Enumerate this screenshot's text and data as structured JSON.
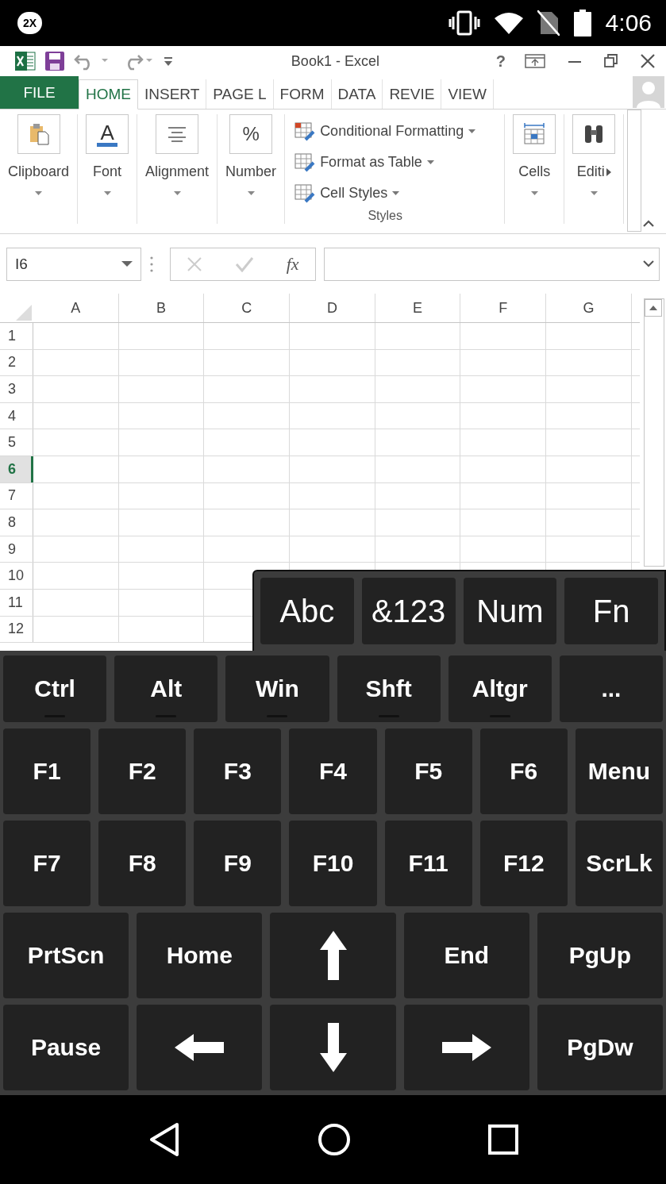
{
  "status_bar": {
    "app_badge": "2X",
    "time": "4:06"
  },
  "window": {
    "title": "Book1 - Excel",
    "help": "?"
  },
  "tabs": [
    {
      "label": "FILE",
      "kind": "file",
      "selected": false
    },
    {
      "label": "HOME",
      "kind": "tab",
      "selected": true
    },
    {
      "label": "INSERT",
      "kind": "tab",
      "selected": false
    },
    {
      "label": "PAGE L",
      "kind": "tab",
      "selected": false
    },
    {
      "label": "FORM",
      "kind": "tab",
      "selected": false
    },
    {
      "label": "DATA",
      "kind": "tab",
      "selected": false
    },
    {
      "label": "REVIE",
      "kind": "tab",
      "selected": false
    },
    {
      "label": "VIEW",
      "kind": "tab",
      "selected": false
    }
  ],
  "ribbon": {
    "groups": [
      {
        "kind": "clipboard",
        "label": "Clipboard"
      },
      {
        "kind": "font",
        "label": "Font",
        "glyph": "A"
      },
      {
        "kind": "alignment",
        "label": "Alignment"
      },
      {
        "kind": "number",
        "label": "Number",
        "glyph": "%"
      },
      {
        "kind": "styles",
        "label": "Styles",
        "items": [
          "Conditional Formatting",
          "Format as Table",
          "Cell Styles"
        ]
      },
      {
        "kind": "cells",
        "label": "Cells"
      },
      {
        "kind": "editing",
        "label": "Editi"
      }
    ]
  },
  "formula_bar": {
    "name_box": "I6",
    "function_button": "fx"
  },
  "sheet": {
    "columns": [
      "A",
      "B",
      "C",
      "D",
      "E",
      "F",
      "G"
    ],
    "rows": [
      {
        "label": "1",
        "selected": false
      },
      {
        "label": "2",
        "selected": false
      },
      {
        "label": "3",
        "selected": false
      },
      {
        "label": "4",
        "selected": false
      },
      {
        "label": "5",
        "selected": false
      },
      {
        "label": "6",
        "selected": true
      },
      {
        "label": "7",
        "selected": false
      },
      {
        "label": "8",
        "selected": false
      },
      {
        "label": "9",
        "selected": false
      },
      {
        "label": "10",
        "selected": false
      },
      {
        "label": "11",
        "selected": false
      },
      {
        "label": "12",
        "selected": false
      }
    ]
  },
  "keyboard": {
    "modes": [
      "Abc",
      "&123",
      "Num",
      "Fn"
    ],
    "modifier_keys": [
      {
        "kind": "toggle",
        "label": "Ctrl",
        "on": false
      },
      {
        "kind": "toggle",
        "label": "Alt",
        "on": false
      },
      {
        "kind": "toggle",
        "label": "Win",
        "on": false
      },
      {
        "kind": "toggle",
        "label": "Shft",
        "on": false
      },
      {
        "kind": "toggle",
        "label": "Altgr",
        "on": false
      },
      {
        "kind": "key",
        "label": "..."
      }
    ],
    "function_rows": [
      [
        {
          "kind": "key",
          "label": "F1"
        },
        {
          "kind": "key",
          "label": "F2"
        },
        {
          "kind": "key",
          "label": "F3"
        },
        {
          "kind": "key",
          "label": "F4"
        },
        {
          "kind": "key",
          "label": "F5"
        },
        {
          "kind": "key",
          "label": "F6"
        },
        {
          "kind": "key",
          "label": "Menu"
        }
      ],
      [
        {
          "kind": "key",
          "label": "F7"
        },
        {
          "kind": "key",
          "label": "F8"
        },
        {
          "kind": "key",
          "label": "F9"
        },
        {
          "kind": "key",
          "label": "F10"
        },
        {
          "kind": "key",
          "label": "F11"
        },
        {
          "kind": "key",
          "label": "F12"
        },
        {
          "kind": "key",
          "label": "ScrLk"
        }
      ]
    ],
    "navigation_rows": [
      [
        {
          "kind": "key",
          "label": "PrtScn"
        },
        {
          "kind": "key",
          "label": "Home"
        },
        {
          "kind": "arrow-up"
        },
        {
          "kind": "key",
          "label": "End"
        },
        {
          "kind": "key",
          "label": "PgUp"
        }
      ],
      [
        {
          "kind": "key",
          "label": "Pause"
        },
        {
          "kind": "arrow-left"
        },
        {
          "kind": "arrow-down"
        },
        {
          "kind": "arrow-right"
        },
        {
          "kind": "key",
          "label": "PgDw"
        }
      ]
    ]
  }
}
